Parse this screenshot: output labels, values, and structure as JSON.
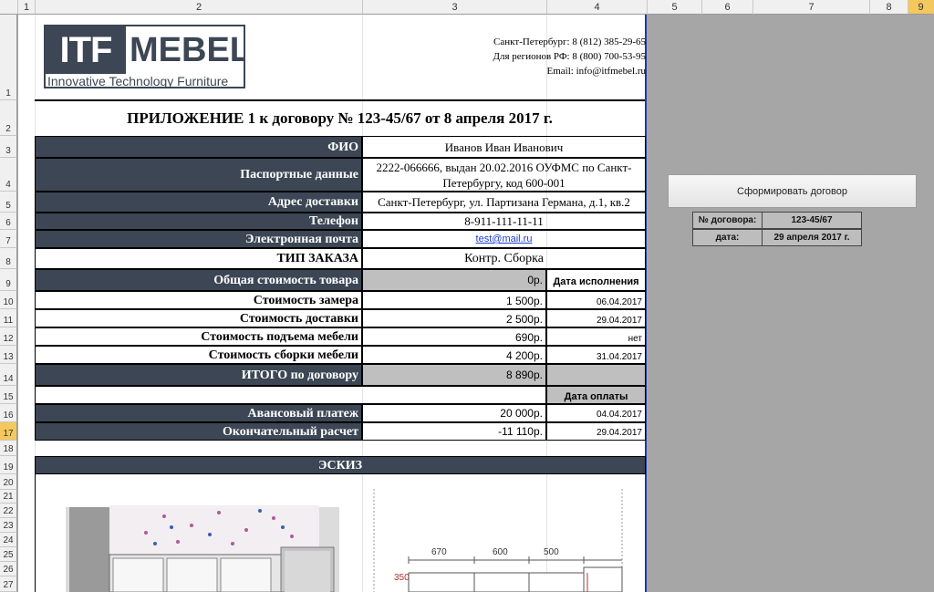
{
  "columns": [
    "1",
    "2",
    "3",
    "4",
    "5",
    "6",
    "7",
    "8",
    "9"
  ],
  "rows": [
    "1",
    "2",
    "3",
    "4",
    "5",
    "6",
    "7",
    "8",
    "9",
    "10",
    "11",
    "12",
    "13",
    "14",
    "15",
    "16",
    "17",
    "18",
    "19",
    "20",
    "21",
    "22",
    "23",
    "24",
    "25",
    "26",
    "27"
  ],
  "logo": {
    "left": "ITF",
    "right": "MEBEL",
    "tagline": "Innovative Technology Furniture"
  },
  "contacts": [
    "Санкт-Петербург: 8 (812) 385-29-65",
    "Для регионов РФ: 8 (800) 700-53-95",
    "Email: info@itfmebel.ru"
  ],
  "title": "ПРИЛОЖЕНИЕ 1 к договору № 123-45/67 от 8 апреля 2017 г.",
  "fields": {
    "fio_label": "ФИО",
    "fio": "Иванов Иван Иванович",
    "passport_label": "Паспортные данные",
    "passport_line1": "2222-066666, выдан 20.02.2016 ОУФМС по Санкт-",
    "passport_line2": "Петербургу, код 600-001",
    "address_label": "Адрес доставки",
    "address": "Санкт-Петербург, ул. Партизана Германа, д.1, кв.2",
    "phone_label": "Телефон",
    "phone": "8-911-111-11-11",
    "email_label": "Электронная почта",
    "email": "test@mail.ru",
    "order_type_label": "ТИП ЗАКАЗА",
    "order_type": "Контр. Сборка"
  },
  "costs": {
    "goods_label": "Общая стоимость товара",
    "goods": "0р.",
    "date_header": "Дата исполнения",
    "measure_label": "Стоимость замера",
    "measure": "1 500р.",
    "measure_date": "06.04.2017",
    "delivery_label": "Стоимость доставки",
    "delivery": "2 500р.",
    "delivery_date": "29.04.2017",
    "lift_label": "Стоимость подъема мебели",
    "lift": "690р.",
    "lift_date": "нет",
    "assembly_label": "Стоимость сборки мебели",
    "assembly": "4 200р.",
    "assembly_date": "31.04.2017",
    "total_label": "ИТОГО по договору",
    "total": "8 890р.",
    "pay_date_header": "Дата оплаты",
    "advance_label": "Авансовый платеж",
    "advance": "20 000р.",
    "advance_date": "04.04.2017",
    "final_label": "Окончательный расчет",
    "final": "-11 110р.",
    "final_date": "29.04.2017"
  },
  "sketch": {
    "title": "ЭСКИЗ",
    "dims": [
      "670",
      "600",
      "500"
    ],
    "height_dim": "350"
  },
  "panel": {
    "button": "Сформировать договор",
    "contract_no_label": "№ договора:",
    "contract_no": "123-45/67",
    "date_label": "дата:",
    "date": "29 апреля 2017 г."
  }
}
